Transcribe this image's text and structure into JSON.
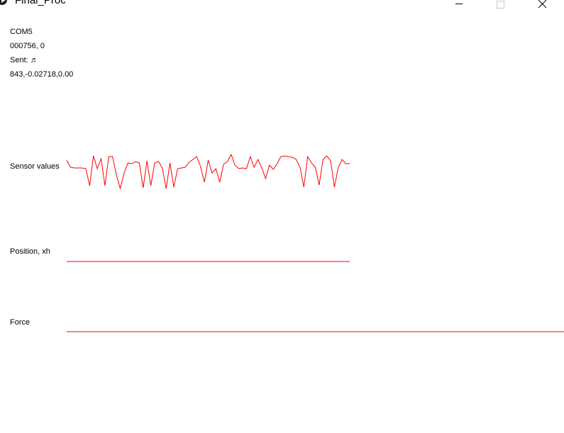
{
  "window": {
    "title": "Final_Proc",
    "app_icon": "processing-play-icon"
  },
  "info": {
    "port": "COM5",
    "reading": "000756, 0",
    "sent_label": "Sent: ♬",
    "values_line": "843,-0.02718,0.00"
  },
  "plots": {
    "sensor_label": "Sensor values",
    "position_label": "Position, xh",
    "force_label": "Force"
  },
  "colors": {
    "trace": "#ff0000",
    "background": "#ffffff",
    "text": "#000000"
  },
  "chart_data": [
    {
      "type": "line",
      "series": [
        {
          "values": [
            226,
            236,
            237,
            237,
            237,
            238,
            262,
            220,
            238,
            224,
            262,
            221,
            221,
            247,
            266,
            244,
            230,
            231,
            228,
            230,
            265,
            227,
            262,
            230,
            228,
            237,
            266,
            230,
            264,
            238,
            237,
            236,
            229,
            225,
            221,
            235,
            257,
            226,
            244,
            238,
            257,
            232,
            228,
            218,
            233,
            238,
            237,
            238,
            221,
            236,
            225,
            237,
            252,
            233,
            239,
            231,
            221,
            220,
            221,
            222,
            225,
            236,
            264,
            221,
            230,
            236,
            261,
            225,
            220,
            227,
            264,
            236,
            225,
            231,
            231
          ]
        }
      ]
    },
    {
      "type": "line",
      "series": [
        {
          "values": [
            0,
            0
          ]
        }
      ]
    },
    {
      "type": "line",
      "series": [
        {
          "values": [
            0,
            0
          ]
        }
      ]
    }
  ]
}
